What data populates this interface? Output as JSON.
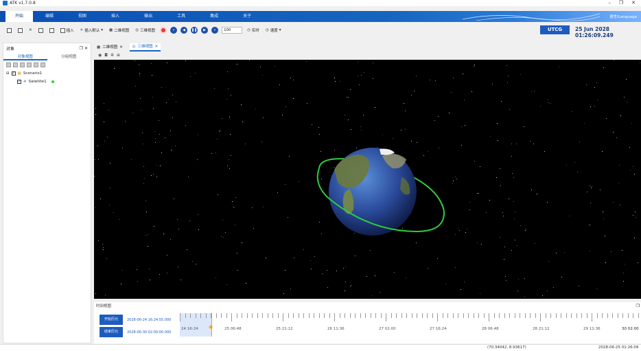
{
  "window": {
    "title": "ATK v1.7.0.8"
  },
  "menu": {
    "items": [
      "开始",
      "编辑",
      "视图",
      "插入",
      "输出",
      "工具",
      "集成",
      "关于"
    ],
    "language": "语言/Language"
  },
  "toolbar": {
    "insert_label": "插入",
    "insert_default_label": "插入默认",
    "view2d_label": "二维视图",
    "view3d_label": "三维视图",
    "speed_value": "100",
    "realtime_label": "实时",
    "rate_label": "速度",
    "time_system": "UTCG",
    "current_time": "25 Jun 2028 01:26:09.249"
  },
  "object_panel": {
    "title": "对象",
    "tabs": [
      "对象视图",
      "分组视图"
    ],
    "tree": [
      {
        "label": "Scenario1",
        "level": 0
      },
      {
        "label": "Satellite1",
        "level": 1
      }
    ]
  },
  "doc_tabs": [
    {
      "label": "二维视图",
      "active": false
    },
    {
      "label": "三维视图",
      "active": true
    }
  ],
  "timeline": {
    "title": "时间视图",
    "start_label": "开始历元",
    "start_value": "2028-06-24 16:24:55.000",
    "end_label": "结束历元",
    "end_value": "2028-06-30 02:00:00.000",
    "ticks": [
      "24 16:24",
      "25 06:48",
      "25 21:12",
      "26 11:36",
      "27 02:00",
      "27 16:24",
      "28 06:48",
      "28 21:12",
      "29 11:36",
      "30 02:00"
    ]
  },
  "status": {
    "coordinates": "(70.34042, 8.93617)",
    "time": "2028-06-25 01:26:09"
  },
  "colors": {
    "accent": "#1565c0",
    "orbit": "#2ecc40",
    "stop": "#e53935"
  }
}
